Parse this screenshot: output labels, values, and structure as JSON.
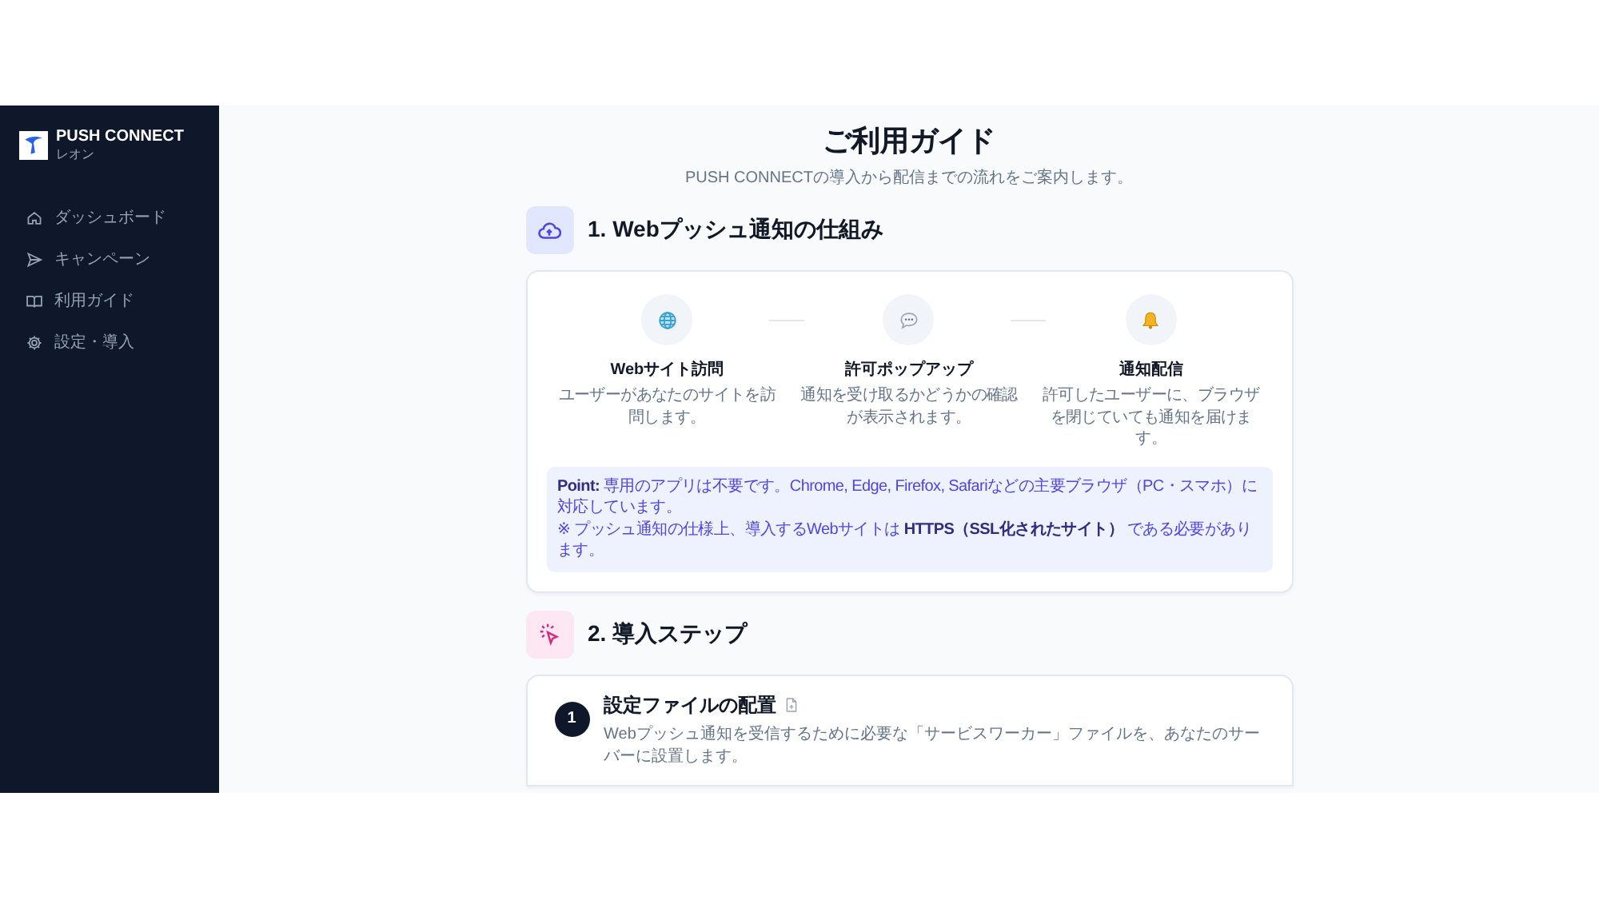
{
  "sidebar": {
    "brand": "PUSH CONNECT",
    "user": "レオン",
    "items": [
      {
        "label": "ダッシュボード"
      },
      {
        "label": "キャンペーン"
      },
      {
        "label": "利用ガイド"
      },
      {
        "label": "設定・導入"
      }
    ]
  },
  "header": {
    "title": "ご利用ガイド",
    "subtitle": "PUSH CONNECTの導入から配信までの流れをご案内します。"
  },
  "section_1": {
    "title": "1. Webプッシュ通知の仕組み",
    "flow": [
      {
        "title": "Webサイト訪問",
        "description": "ユーザーがあなたのサイトを訪問します。"
      },
      {
        "title": "許可ポップアップ",
        "description": "通知を受け取るかどうかの確認が表示されます。"
      },
      {
        "title": "通知配信",
        "description": "許可したユーザーに、ブラウザを閉じていても通知を届けます。"
      }
    ],
    "note": [
      "**Point:** 専用のアプリは不要です。Chrome, Edge, Firefox, Safariなどの主要ブラウザ（PC・スマホ）に対応しています。",
      "※ プッシュ通知の仕様上、導入するWebサイトは **HTTPS（SSL化されたサイト）** である必要があります。"
    ]
  },
  "section_2": {
    "title": "2. 導入ステップ",
    "steps": [
      {
        "number": "1",
        "title": "設定ファイルの配置",
        "description": "Webプッシュ通知を受信するために必要な「サービスワーカー」ファイルを、あなたのサーバーに設置します。"
      }
    ]
  }
}
